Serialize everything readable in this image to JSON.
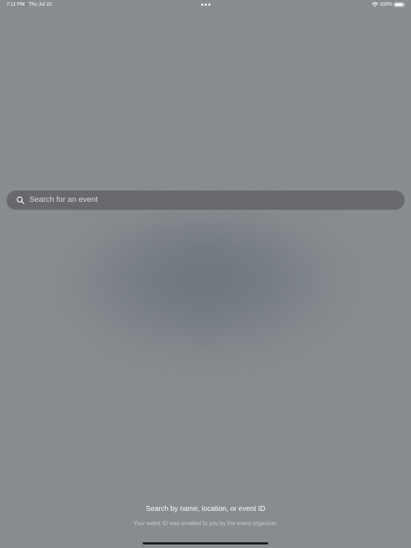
{
  "status_bar": {
    "time": "7:11 PM",
    "date": "Thu Jul 20",
    "battery": "100%",
    "wifi_icon": "wifi-icon",
    "battery_icon": "battery-icon"
  },
  "search": {
    "placeholder": "Search for an event",
    "icon": "search-icon"
  },
  "help": {
    "title": "Search by name, location, or event ID",
    "subtitle": "Your event ID was emailed to you by the event organizer."
  }
}
